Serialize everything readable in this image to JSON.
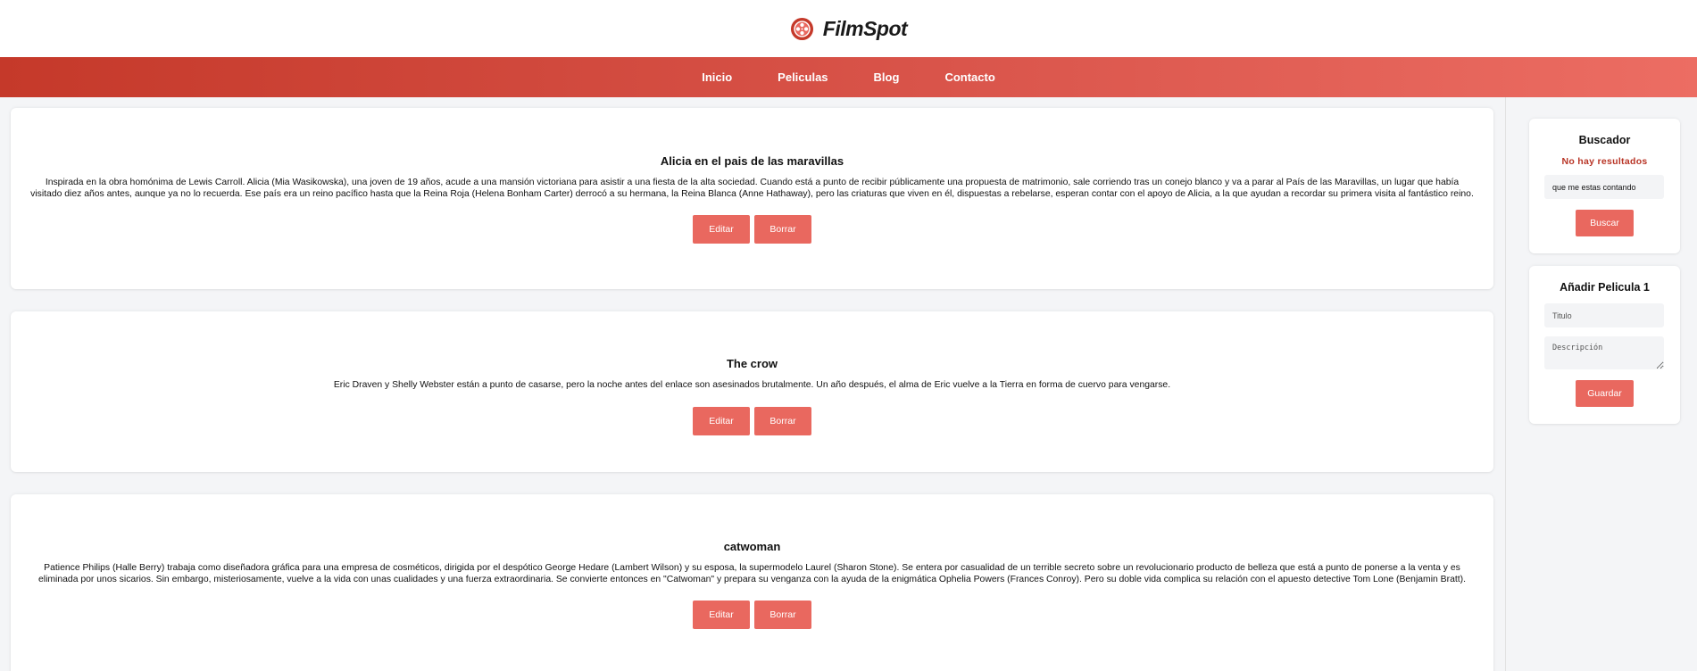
{
  "brand": {
    "name": "FilmSpot",
    "accent": "#e9685f",
    "nav_gradient": [
      "#c5392a",
      "#ec6d63"
    ],
    "error_color": "#b83425"
  },
  "nav": {
    "items": [
      {
        "label": "Inicio"
      },
      {
        "label": "Peliculas"
      },
      {
        "label": "Blog"
      },
      {
        "label": "Contacto"
      }
    ]
  },
  "films": [
    {
      "title": "Alicia en el pais de las maravillas",
      "description": "Inspirada en la obra homónima de Lewis Carroll. Alicia (Mia Wasikowska), una joven de 19 años, acude a una mansión victoriana para asistir a una fiesta de la alta sociedad. Cuando está a punto de recibir públicamente una propuesta de matrimonio, sale corriendo tras un conejo blanco y va a parar al País de las Maravillas, un lugar que había visitado diez años antes, aunque ya no lo recuerda. Ese país era un reino pacífico hasta que la Reina Roja (Helena Bonham Carter) derrocó a su hermana, la Reina Blanca (Anne Hathaway), pero las criaturas que viven en él, dispuestas a rebelarse, esperan contar con el apoyo de Alicia, a la que ayudan a recordar su primera visita al fantástico reino.",
      "edit_label": "Editar",
      "delete_label": "Borrar"
    },
    {
      "title": "The crow",
      "description": "Eric Draven y Shelly Webster están a punto de casarse, pero la noche antes del enlace son asesinados brutalmente. Un año después, el alma de Eric vuelve a la Tierra en forma de cuervo para vengarse.",
      "edit_label": "Editar",
      "delete_label": "Borrar"
    },
    {
      "title": "catwoman",
      "description": "Patience Philips (Halle Berry) trabaja como diseñadora gráfica para una empresa de cosméticos, dirigida por el despótico George Hedare (Lambert Wilson) y su esposa, la supermodelo Laurel (Sharon Stone). Se entera por casualidad de un terrible secreto sobre un revolucionario producto de belleza que está a punto de ponerse a la venta y es eliminada por unos sicarios. Sin embargo, misteriosamente, vuelve a la vida con unas cualidades y una fuerza extraordinaria. Se convierte entonces en \"Catwoman\" y prepara su venganza con la ayuda de la enigmática Ophelia Powers (Frances Conroy). Pero su doble vida complica su relación con el apuesto detective Tom Lone (Benjamin Bratt).",
      "edit_label": "Editar",
      "delete_label": "Borrar"
    }
  ],
  "search_widget": {
    "title": "Buscador",
    "status": "No hay resultados",
    "query_value": "que me estas contando",
    "button_label": "Buscar"
  },
  "add_widget": {
    "title": "Añadir Pelicula 1",
    "title_placeholder": "Titulo",
    "description_placeholder": "Descripción",
    "button_label": "Guardar"
  }
}
